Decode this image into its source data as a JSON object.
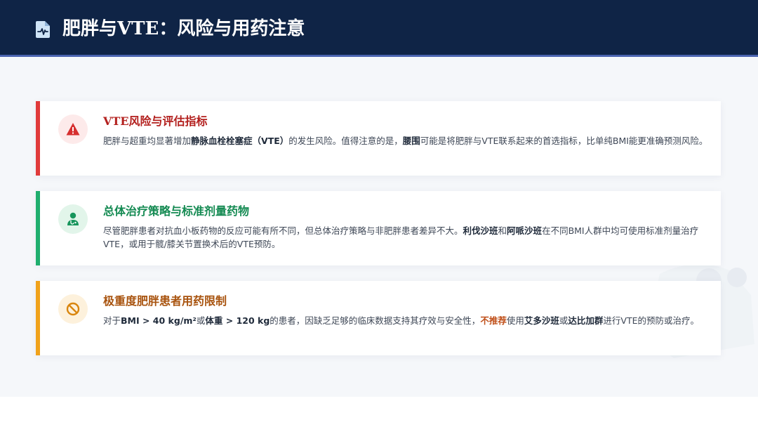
{
  "header": {
    "title": "肥胖与VTE：风险与用药注意",
    "icon": "medical-document-icon"
  },
  "colors": {
    "header_bg": "#0f2446",
    "red": "#e03a3a",
    "green": "#1fae6e",
    "orange": "#f0a21a"
  },
  "cards": [
    {
      "icon": "warning-triangle-icon",
      "title": "VTE风险与评估指标",
      "body": [
        {
          "t": "肥胖与超重均显著增加"
        },
        {
          "t": "静脉血栓栓塞症（VTE）",
          "b": 1
        },
        {
          "t": "的发生风险。值得注意的是，"
        },
        {
          "t": "腰围",
          "b": 1
        },
        {
          "t": "可能是将肥胖与VTE联系起来的首选指标，比单纯BMI能更准确预测风险。"
        }
      ]
    },
    {
      "icon": "doctor-icon",
      "title": "总体治疗策略与标准剂量药物",
      "body": [
        {
          "t": "尽管肥胖患者对抗血小板药物的反应可能有所不同，但总体治疗策略与非肥胖患者差异不大。"
        },
        {
          "t": "利伐沙班",
          "b": 1
        },
        {
          "t": "和"
        },
        {
          "t": "阿哌沙班",
          "b": 1
        },
        {
          "t": "在不同BMI人群中均可使用标准剂量治疗VTE，或用于髋/膝关节置换术后的VTE预防。"
        }
      ]
    },
    {
      "icon": "prohibited-icon",
      "title": "极重度肥胖患者用药限制",
      "body": [
        {
          "t": "对于"
        },
        {
          "t": "BMI > 40 kg/m²",
          "b": 1
        },
        {
          "t": "或"
        },
        {
          "t": "体重 > 120 kg",
          "b": 1
        },
        {
          "t": "的患者，因缺乏足够的临床数据支持其疗效与安全性，"
        },
        {
          "t": "不推荐",
          "b": 2
        },
        {
          "t": "使用"
        },
        {
          "t": "艾多沙班",
          "b": 1
        },
        {
          "t": "或"
        },
        {
          "t": "达比加群",
          "b": 1
        },
        {
          "t": "进行VTE的预防或治疗。"
        }
      ]
    }
  ]
}
